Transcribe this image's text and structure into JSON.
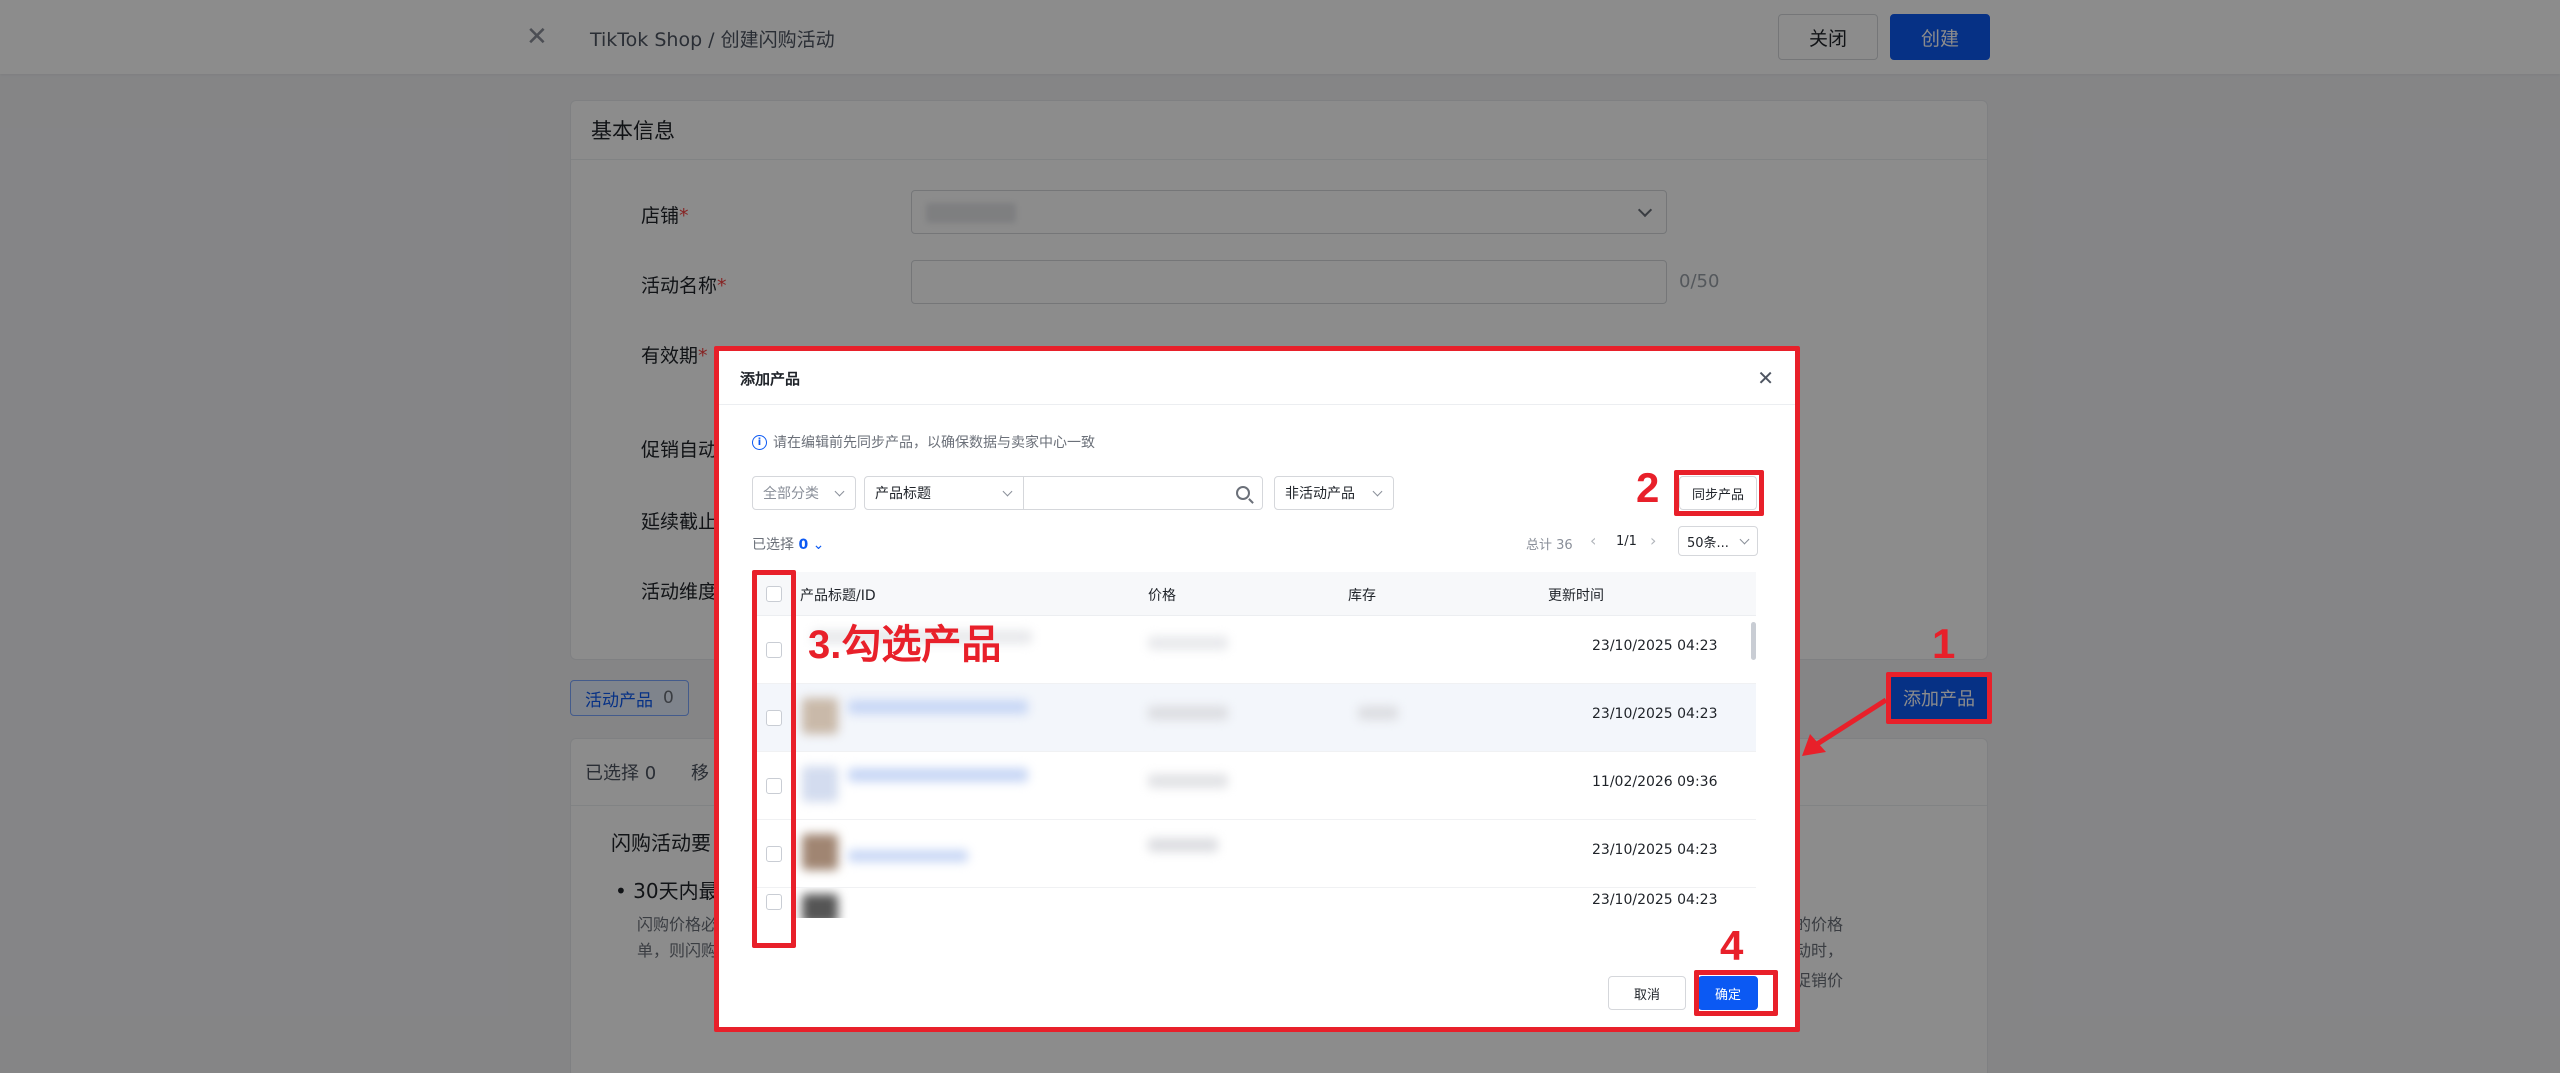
{
  "header": {
    "breadcrumb": "TikTok Shop  /  创建闪购活动",
    "close_label": "关闭",
    "create_label": "创建"
  },
  "basic_info": {
    "title": "基本信息",
    "store_label": "店铺",
    "name_label": "活动名称",
    "name_counter": "0/50",
    "validity_label": "有效期",
    "promo_label": "促销自动",
    "extend_label": "延续截止",
    "dimension_label": "活动维度"
  },
  "products_section": {
    "tab_label": "活动产品",
    "tab_count": "0",
    "add_button": "添加产品",
    "selected_text": "已选择 0",
    "remove_text": "移"
  },
  "rules": {
    "title": "闪购活动要",
    "bullet": "30天内最",
    "line1": "闪购价格必",
    "line2": "单，则闪购",
    "right1": "的价格",
    "right2": "动时，",
    "right3": "促销价"
  },
  "modal": {
    "title": "添加产品",
    "notice": "请在编辑前先同步产品，以确保数据与卖家中心一致",
    "category_select": "全部分类",
    "field_select": "产品标题",
    "status_select": "非活动产品",
    "sync_button": "同步产品",
    "selected_label": "已选择",
    "selected_count": "0",
    "total": "总计 36",
    "page": "1/1",
    "page_size": "50条...",
    "columns": [
      "产品标题/ID",
      "价格",
      "库存",
      "更新时间"
    ],
    "rows": [
      {
        "time": "23/10/2025 04:23"
      },
      {
        "time": "23/10/2025 04:23"
      },
      {
        "time": "11/02/2026 09:36"
      },
      {
        "time": "23/10/2025 04:23"
      },
      {
        "time": "23/10/2025 04:23"
      }
    ],
    "cancel_label": "取消",
    "confirm_label": "确定"
  },
  "annotations": {
    "step1": "1",
    "step2": "2",
    "step3": "3.勾选产品",
    "step4": "4"
  },
  "colors": {
    "primary": "#0b59f3",
    "annotation_red": "#e8202a"
  }
}
